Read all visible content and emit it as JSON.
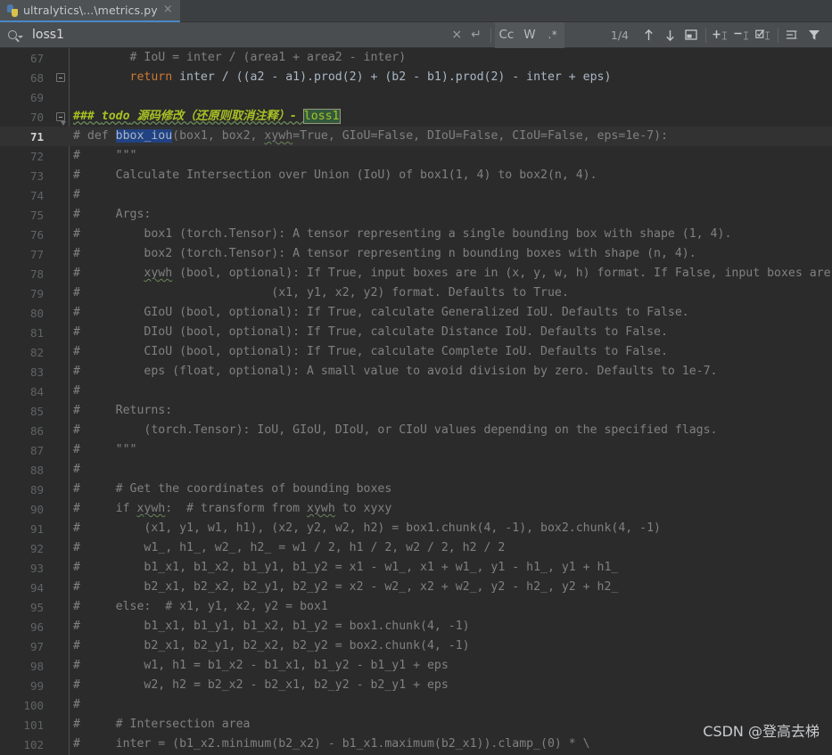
{
  "tab": {
    "title": "ultralytics\\...\\metrics.py",
    "icon": "python-file-icon",
    "close_label": "×"
  },
  "find_toolbar": {
    "search_icon": "search-icon",
    "query": "loss1",
    "placeholder": "Search",
    "clear_label": "×",
    "newline_label": "↵",
    "match_case_label": "Cc",
    "words_label": "W",
    "regex_label": ".*",
    "match_counter": "1/4",
    "prev_match_label": "↑",
    "next_match_label": "↓",
    "open_in_find_window": "open-in-find-window-icon",
    "add_selection": "add-selection-icon",
    "remove_selection": "remove-selection-icon",
    "select_all_occurrences": "select-all-occurrences-icon",
    "find_in_selection": "find-in-selection-icon",
    "filter_label": "filter-icon"
  },
  "editor": {
    "current_line": 71,
    "first_line": 67,
    "lines": [
      {
        "n": 67,
        "fold": "",
        "segs": [
          {
            "t": "        # IoU = inter / (area1 + area2 - inter)",
            "c": "c-comment"
          }
        ]
      },
      {
        "n": 68,
        "fold": "end",
        "segs": [
          {
            "t": "        ",
            "c": "c-plain"
          },
          {
            "t": "return",
            "c": "c-keyword"
          },
          {
            "t": " inter / ((a2 - a1).prod(2) + (b2 - b1).prod(2) - inter + eps)",
            "c": "c-plain"
          }
        ]
      },
      {
        "n": 69,
        "fold": "",
        "segs": [
          {
            "t": "",
            "c": "c-plain"
          }
        ]
      },
      {
        "n": 70,
        "fold": "start",
        "segs": [
          {
            "t": "### ",
            "c": "c-todo c-todo-wave"
          },
          {
            "t": "todo",
            "c": "c-todo c-todo-wave"
          },
          {
            "t": " 源码修改（还原则取消注释）- ",
            "c": "c-todo c-todo-wave"
          },
          {
            "t": "loss1",
            "c": "hl-search"
          }
        ]
      },
      {
        "n": 71,
        "fold": "",
        "segs": [
          {
            "t": "# def ",
            "c": "c-comment"
          },
          {
            "t": "bbox_iou",
            "c": "hl-selection"
          },
          {
            "t": "(box1, box2, ",
            "c": "c-comment"
          },
          {
            "t": "xywh",
            "c": "c-comment typo"
          },
          {
            "t": "=True, GIoU=False, DIoU=False, CIoU=False, eps=1e-7):",
            "c": "c-comment"
          }
        ]
      },
      {
        "n": 72,
        "fold": "",
        "segs": [
          {
            "t": "#     \"\"\"",
            "c": "c-comment"
          }
        ]
      },
      {
        "n": 73,
        "fold": "",
        "segs": [
          {
            "t": "#     Calculate Intersection over Union (IoU) of box1(1, 4) to box2(n, 4).",
            "c": "c-comment"
          }
        ]
      },
      {
        "n": 74,
        "fold": "",
        "segs": [
          {
            "t": "#",
            "c": "c-comment"
          }
        ]
      },
      {
        "n": 75,
        "fold": "",
        "segs": [
          {
            "t": "#     Args:",
            "c": "c-comment"
          }
        ]
      },
      {
        "n": 76,
        "fold": "",
        "segs": [
          {
            "t": "#         box1 (torch.Tensor): A tensor representing a single bounding box with shape (1, 4).",
            "c": "c-comment"
          }
        ]
      },
      {
        "n": 77,
        "fold": "",
        "segs": [
          {
            "t": "#         box2 (torch.Tensor): A tensor representing n bounding boxes with shape (n, 4).",
            "c": "c-comment"
          }
        ]
      },
      {
        "n": 78,
        "fold": "",
        "segs": [
          {
            "t": "#         ",
            "c": "c-comment"
          },
          {
            "t": "xywh",
            "c": "c-comment typo"
          },
          {
            "t": " (bool, optional): If True, input boxes are in (x, y, w, h) format. If False, input boxes are",
            "c": "c-comment"
          }
        ]
      },
      {
        "n": 79,
        "fold": "",
        "segs": [
          {
            "t": "#                           (x1, y1, x2, y2) format. Defaults to True.",
            "c": "c-comment"
          }
        ]
      },
      {
        "n": 80,
        "fold": "",
        "segs": [
          {
            "t": "#         GIoU (bool, optional): If True, calculate Generalized IoU. Defaults to False.",
            "c": "c-comment"
          }
        ]
      },
      {
        "n": 81,
        "fold": "",
        "segs": [
          {
            "t": "#         DIoU (bool, optional): If True, calculate Distance IoU. Defaults to False.",
            "c": "c-comment"
          }
        ]
      },
      {
        "n": 82,
        "fold": "",
        "segs": [
          {
            "t": "#         CIoU (bool, optional): If True, calculate Complete IoU. Defaults to False.",
            "c": "c-comment"
          }
        ]
      },
      {
        "n": 83,
        "fold": "",
        "segs": [
          {
            "t": "#         eps (float, optional): A small value to avoid division by zero. Defaults to 1e-7.",
            "c": "c-comment"
          }
        ]
      },
      {
        "n": 84,
        "fold": "",
        "segs": [
          {
            "t": "#",
            "c": "c-comment"
          }
        ]
      },
      {
        "n": 85,
        "fold": "",
        "segs": [
          {
            "t": "#     Returns:",
            "c": "c-comment"
          }
        ]
      },
      {
        "n": 86,
        "fold": "",
        "segs": [
          {
            "t": "#         (torch.Tensor): IoU, GIoU, DIoU, or CIoU values depending on the specified flags.",
            "c": "c-comment"
          }
        ]
      },
      {
        "n": 87,
        "fold": "",
        "segs": [
          {
            "t": "#     \"\"\"",
            "c": "c-comment"
          }
        ]
      },
      {
        "n": 88,
        "fold": "",
        "segs": [
          {
            "t": "#",
            "c": "c-comment"
          }
        ]
      },
      {
        "n": 89,
        "fold": "",
        "segs": [
          {
            "t": "#     # Get the coordinates of bounding boxes",
            "c": "c-comment"
          }
        ]
      },
      {
        "n": 90,
        "fold": "",
        "segs": [
          {
            "t": "#     if ",
            "c": "c-comment"
          },
          {
            "t": "xywh",
            "c": "c-comment typo"
          },
          {
            "t": ":  # transform from ",
            "c": "c-comment"
          },
          {
            "t": "xywh",
            "c": "c-comment typo"
          },
          {
            "t": " to xyxy",
            "c": "c-comment"
          }
        ]
      },
      {
        "n": 91,
        "fold": "",
        "segs": [
          {
            "t": "#         (x1, y1, w1, h1), (x2, y2, w2, h2) = box1.chunk(4, -1), box2.chunk(4, -1)",
            "c": "c-comment"
          }
        ]
      },
      {
        "n": 92,
        "fold": "",
        "segs": [
          {
            "t": "#         w1_, h1_, w2_, h2_ = w1 / 2, h1 / 2, w2 / 2, h2 / 2",
            "c": "c-comment"
          }
        ]
      },
      {
        "n": 93,
        "fold": "",
        "segs": [
          {
            "t": "#         b1_x1, b1_x2, b1_y1, b1_y2 = x1 - w1_, x1 + w1_, y1 - h1_, y1 + h1_",
            "c": "c-comment"
          }
        ]
      },
      {
        "n": 94,
        "fold": "",
        "segs": [
          {
            "t": "#         b2_x1, b2_x2, b2_y1, b2_y2 = x2 - w2_, x2 + w2_, y2 - h2_, y2 + h2_",
            "c": "c-comment"
          }
        ]
      },
      {
        "n": 95,
        "fold": "",
        "segs": [
          {
            "t": "#     else:  # x1, y1, x2, y2 = box1",
            "c": "c-comment"
          }
        ]
      },
      {
        "n": 96,
        "fold": "",
        "segs": [
          {
            "t": "#         b1_x1, b1_y1, b1_x2, b1_y2 = box1.chunk(4, -1)",
            "c": "c-comment"
          }
        ]
      },
      {
        "n": 97,
        "fold": "",
        "segs": [
          {
            "t": "#         b2_x1, b2_y1, b2_x2, b2_y2 = box2.chunk(4, -1)",
            "c": "c-comment"
          }
        ]
      },
      {
        "n": 98,
        "fold": "",
        "segs": [
          {
            "t": "#         w1, h1 = b1_x2 - b1_x1, b1_y2 - b1_y1 + eps",
            "c": "c-comment"
          }
        ]
      },
      {
        "n": 99,
        "fold": "",
        "segs": [
          {
            "t": "#         w2, h2 = b2_x2 - b2_x1, b2_y2 - b2_y1 + eps",
            "c": "c-comment"
          }
        ]
      },
      {
        "n": 100,
        "fold": "",
        "segs": [
          {
            "t": "#",
            "c": "c-comment"
          }
        ]
      },
      {
        "n": 101,
        "fold": "",
        "segs": [
          {
            "t": "#     # Intersection area",
            "c": "c-comment"
          }
        ]
      },
      {
        "n": 102,
        "fold": "",
        "segs": [
          {
            "t": "#     inter = (b1_x2.minimum(b2_x2) - b1_x1.maximum(b2_x1)).clamp_(0) * \\",
            "c": "c-comment"
          }
        ]
      }
    ]
  },
  "watermark": {
    "text": "CSDN @登高去梯"
  },
  "colors": {
    "editor_bg": "#2b2b2b",
    "toolbar_bg": "#4a4d4f",
    "tabbar_bg": "#3c3f41",
    "active_tab_underline": "#4a88c7",
    "comment": "#808080",
    "keyword": "#cc7832",
    "todo": "#a8c023",
    "search_highlight": "#32593d",
    "selection_highlight": "#214283",
    "typo_wave": "#6a8759"
  }
}
